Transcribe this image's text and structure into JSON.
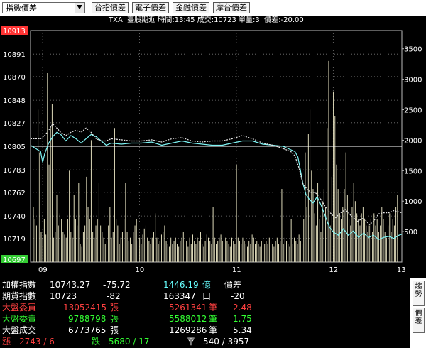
{
  "toolbar": {
    "dropdown_value": "指數價差",
    "buttons": [
      "台指價差",
      "電子價差",
      "金融價差",
      "摩台價差"
    ]
  },
  "info_bar": "TXA  臺股期近 時間:13:45 成交:10723 單量:3  價差:-20.00",
  "colors": {
    "background": "#000000",
    "futures_line": "#7ff6f6",
    "index_line": "#e6e6e6",
    "volume_bars": "#dcd8b8",
    "high_label_bg": "#ff3333",
    "low_label_bg": "#33cc33",
    "red_text": "#ff4040",
    "green_text": "#33ff33",
    "cyan_text": "#66ffff"
  },
  "chart_data": {
    "type": "line",
    "x_ticks": [
      "09",
      "10",
      "11",
      "12",
      "13"
    ],
    "y_price_ticks": [
      "10913",
      "10891",
      "10870",
      "10848",
      "10827",
      "10805",
      "10783",
      "10762",
      "10740",
      "10719",
      "10697"
    ],
    "y_price_range": [
      10697,
      10913
    ],
    "reference_price": 10805,
    "y_volume_ticks": [
      "3500",
      "3000",
      "2500",
      "2000",
      "1500",
      "1000",
      "500"
    ],
    "y_volume_range": [
      0,
      3800
    ],
    "series": [
      {
        "key": "futures",
        "color": "#7ff6f6",
        "points": [
          [
            0,
            10806
          ],
          [
            5,
            10803
          ],
          [
            10,
            10800
          ],
          [
            12,
            10790
          ],
          [
            14,
            10798
          ],
          [
            18,
            10808
          ],
          [
            22,
            10814
          ],
          [
            26,
            10818
          ],
          [
            30,
            10816
          ],
          [
            35,
            10810
          ],
          [
            40,
            10815
          ],
          [
            45,
            10812
          ],
          [
            50,
            10808
          ],
          [
            55,
            10812
          ],
          [
            60,
            10816
          ],
          [
            65,
            10814
          ],
          [
            70,
            10810
          ],
          [
            75,
            10806
          ],
          [
            80,
            10808
          ],
          [
            90,
            10807
          ],
          [
            100,
            10808
          ],
          [
            110,
            10808
          ],
          [
            120,
            10809
          ],
          [
            130,
            10806
          ],
          [
            140,
            10808
          ],
          [
            150,
            10810
          ],
          [
            160,
            10808
          ],
          [
            170,
            10807
          ],
          [
            180,
            10806
          ],
          [
            190,
            10806
          ],
          [
            200,
            10808
          ],
          [
            210,
            10810
          ],
          [
            220,
            10810
          ],
          [
            230,
            10807
          ],
          [
            240,
            10806
          ],
          [
            250,
            10805
          ],
          [
            255,
            10803
          ],
          [
            262,
            10800
          ],
          [
            265,
            10795
          ],
          [
            268,
            10780
          ],
          [
            270,
            10770
          ],
          [
            273,
            10760
          ],
          [
            276,
            10756
          ],
          [
            280,
            10752
          ],
          [
            284,
            10758
          ],
          [
            288,
            10750
          ],
          [
            292,
            10740
          ],
          [
            296,
            10730
          ],
          [
            300,
            10725
          ],
          [
            305,
            10722
          ],
          [
            310,
            10728
          ],
          [
            315,
            10722
          ],
          [
            320,
            10726
          ],
          [
            325,
            10720
          ],
          [
            330,
            10724
          ],
          [
            335,
            10720
          ],
          [
            340,
            10722
          ],
          [
            345,
            10718
          ],
          [
            350,
            10720
          ],
          [
            355,
            10721
          ],
          [
            360,
            10719
          ],
          [
            365,
            10722
          ],
          [
            368,
            10723
          ]
        ]
      },
      {
        "key": "index",
        "color": "#e6e6e6",
        "points": [
          [
            0,
            10812
          ],
          [
            6,
            10812
          ],
          [
            10,
            10812
          ],
          [
            14,
            10815
          ],
          [
            18,
            10820
          ],
          [
            22,
            10826
          ],
          [
            26,
            10822
          ],
          [
            30,
            10818
          ],
          [
            35,
            10815
          ],
          [
            40,
            10818
          ],
          [
            45,
            10820
          ],
          [
            50,
            10818
          ],
          [
            55,
            10822
          ],
          [
            60,
            10818
          ],
          [
            65,
            10812
          ],
          [
            70,
            10810
          ],
          [
            75,
            10810
          ],
          [
            80,
            10812
          ],
          [
            90,
            10811
          ],
          [
            100,
            10810
          ],
          [
            110,
            10810
          ],
          [
            120,
            10811
          ],
          [
            130,
            10809
          ],
          [
            140,
            10812
          ],
          [
            150,
            10813
          ],
          [
            160,
            10810
          ],
          [
            170,
            10809
          ],
          [
            180,
            10810
          ],
          [
            190,
            10810
          ],
          [
            200,
            10812
          ],
          [
            210,
            10815
          ],
          [
            220,
            10812
          ],
          [
            230,
            10808
          ],
          [
            240,
            10806
          ],
          [
            250,
            10803
          ],
          [
            258,
            10800
          ],
          [
            262,
            10796
          ],
          [
            266,
            10785
          ],
          [
            270,
            10770
          ],
          [
            274,
            10765
          ],
          [
            278,
            10762
          ],
          [
            282,
            10762
          ],
          [
            286,
            10758
          ],
          [
            290,
            10752
          ],
          [
            294,
            10746
          ],
          [
            298,
            10742
          ],
          [
            302,
            10738
          ],
          [
            306,
            10742
          ],
          [
            312,
            10746
          ],
          [
            318,
            10740
          ],
          [
            324,
            10735
          ],
          [
            330,
            10738
          ],
          [
            336,
            10732
          ],
          [
            340,
            10735
          ],
          [
            345,
            10742
          ],
          [
            350,
            10743
          ],
          [
            355,
            10743
          ],
          [
            360,
            10745
          ],
          [
            368,
            10743
          ]
        ]
      }
    ],
    "volume_values": [
      900,
      700,
      600,
      2500,
      1800,
      500,
      400,
      700,
      450,
      3100,
      1600,
      2200,
      2600,
      400,
      500,
      1100,
      600,
      800,
      700,
      500,
      450,
      400,
      700,
      1500,
      500,
      400,
      1100,
      700,
      600,
      1300,
      300,
      250,
      500,
      600,
      1400,
      900,
      700,
      2000,
      500,
      400,
      600,
      700,
      1300,
      600,
      500,
      400,
      300,
      350,
      600,
      900,
      400,
      500,
      2200,
      700,
      600,
      300,
      400,
      500,
      700,
      1300,
      500,
      350,
      400,
      300,
      500,
      600,
      700,
      350,
      400,
      300,
      450,
      550,
      600,
      400,
      350,
      300,
      400,
      500,
      800,
      400,
      300,
      350,
      450,
      500,
      600,
      350,
      300,
      250,
      400,
      300,
      350,
      400,
      300,
      250,
      350,
      400,
      500,
      300,
      350,
      250,
      400,
      300,
      450,
      350,
      300,
      400,
      350,
      500,
      300,
      250,
      350,
      450,
      400,
      350,
      300,
      900,
      400,
      300,
      350,
      400,
      450,
      350,
      300,
      400,
      350,
      300,
      250,
      400,
      350,
      300,
      1600,
      400,
      350,
      300,
      400,
      350,
      300,
      250,
      350,
      300,
      450,
      400,
      300,
      350,
      300,
      250,
      350,
      400,
      300,
      350,
      300,
      400,
      350,
      300,
      250,
      350,
      400,
      300,
      350,
      1200,
      300,
      400,
      350,
      300,
      250,
      700,
      300,
      400,
      350,
      300,
      450,
      350,
      300,
      700,
      1800,
      900,
      2100,
      2500,
      1500,
      1200,
      800,
      600,
      1300,
      700,
      500,
      1000,
      1200,
      900,
      2200,
      3300,
      600,
      1400,
      2800,
      2400,
      1600,
      1200,
      800,
      700,
      900,
      1200,
      1800,
      1100,
      700,
      600,
      900,
      1300,
      1000,
      800,
      700,
      600,
      800,
      900,
      700,
      600,
      500,
      600,
      700,
      500,
      800,
      600,
      700,
      500,
      600,
      900,
      700,
      500,
      400,
      600,
      800,
      500,
      700,
      600,
      900,
      1100
    ]
  },
  "bottom": {
    "rows": [
      {
        "label": "加權指數",
        "v1": "10743.27",
        "v2": "-75.72",
        "v3": "1446.19",
        "unit3": "億",
        "v4": "價差"
      },
      {
        "label": "期貨指數",
        "v1": "10723",
        "v2": "-82",
        "v3": "163347",
        "unit3": "口",
        "v4": "-20"
      },
      {
        "label": "大盤委買",
        "v1": "13052415",
        "unit1": "張",
        "v3": "5261341",
        "unit3": "筆",
        "v4": "2.48"
      },
      {
        "label": "大盤委賣",
        "v1": "9788798",
        "unit1": "張",
        "v3": "5588012",
        "unit3": "筆",
        "v4": "1.75"
      },
      {
        "label": "大盤成交",
        "v1": "6773765",
        "unit1": "張",
        "v3": "1269286",
        "unit3": "筆",
        "v4": "5.34"
      }
    ],
    "summary": {
      "up_label": "漲",
      "up_value": "2743 / 6",
      "down_label": "跌",
      "down_value": "5680 / 17",
      "flat_label": "平",
      "flat_value": "540 / 3957"
    },
    "right_tabs": [
      "趨勢",
      "價差"
    ]
  }
}
